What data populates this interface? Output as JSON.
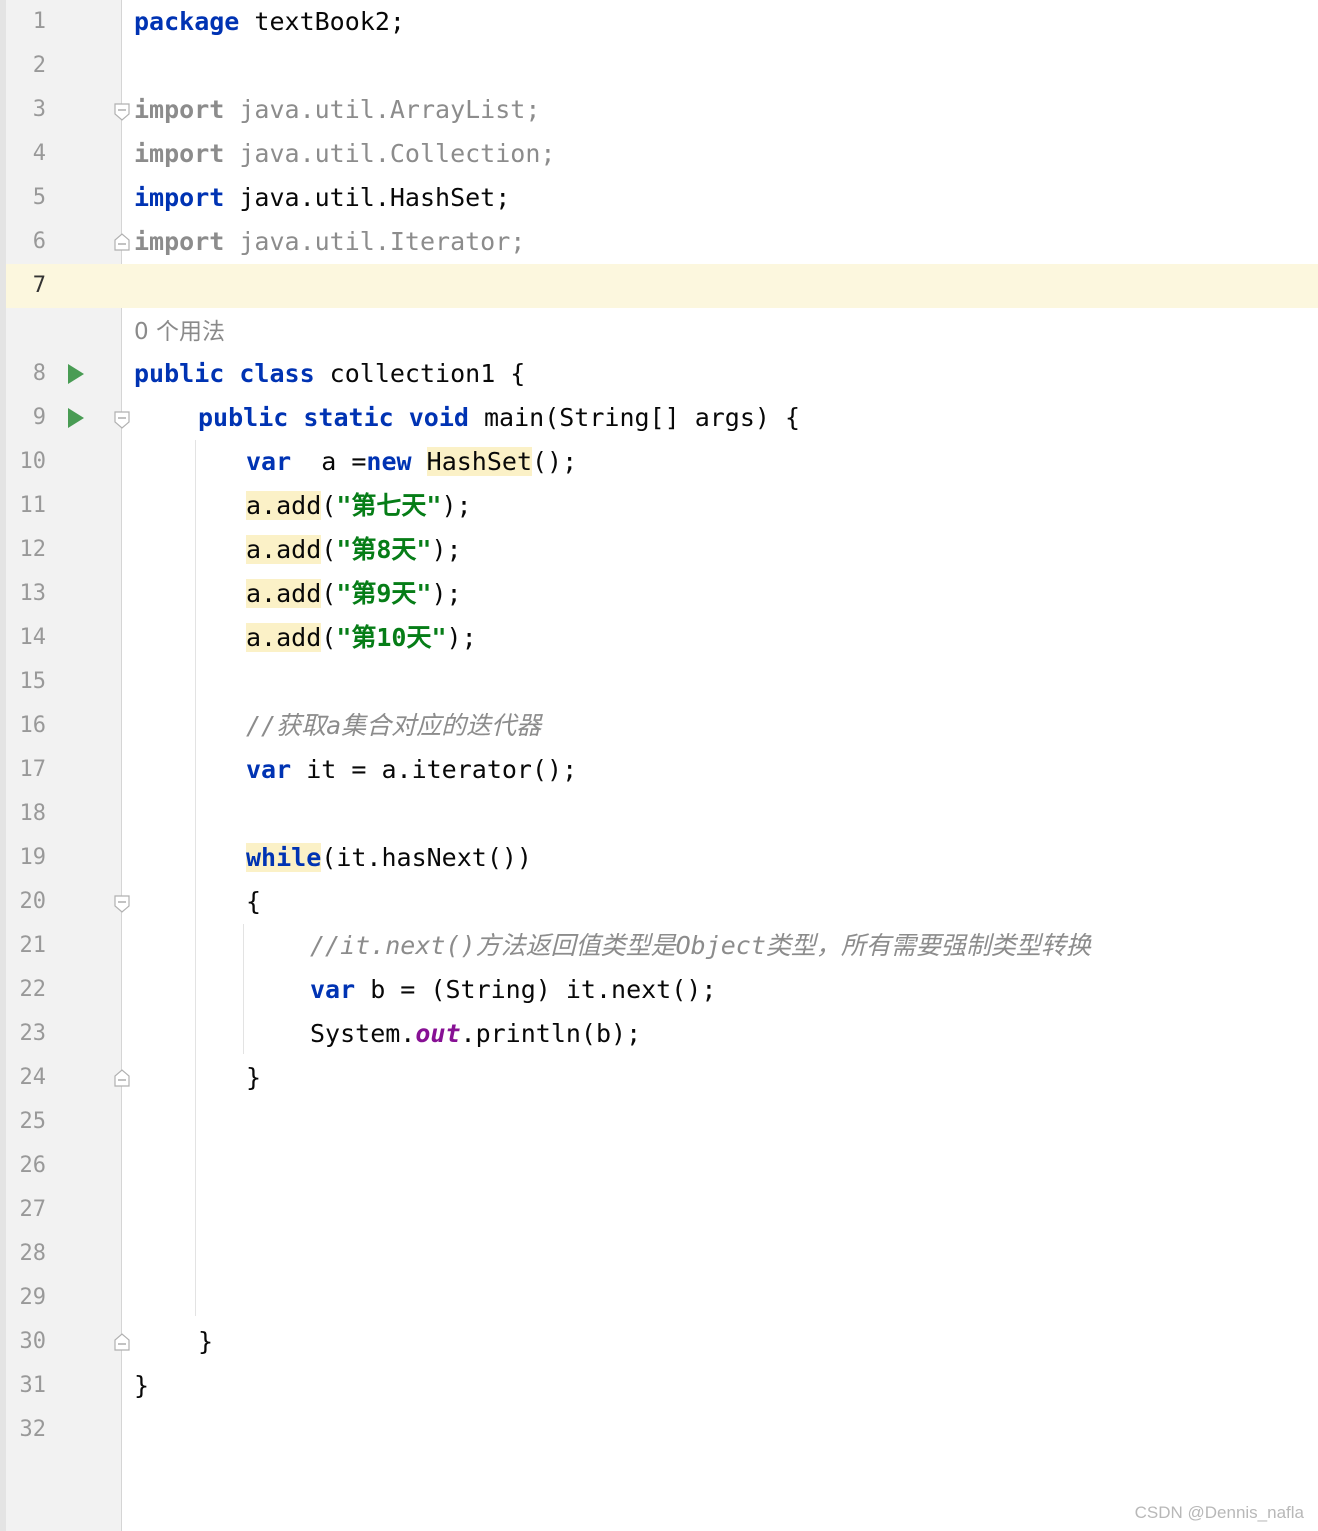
{
  "editor": {
    "line_numbers": [
      "1",
      "2",
      "3",
      "4",
      "5",
      "6",
      "7",
      "8",
      "9",
      "10",
      "11",
      "12",
      "13",
      "14",
      "15",
      "16",
      "17",
      "18",
      "19",
      "20",
      "21",
      "22",
      "23",
      "24",
      "25",
      "26",
      "27",
      "28",
      "29",
      "30",
      "31",
      "32"
    ],
    "current_line": "7",
    "usage_hint": "0 个用法",
    "code": {
      "l1": {
        "kw": "package",
        "rest": " textBook2;"
      },
      "l3": {
        "kw": "import",
        "rest": " java.util.ArrayList;"
      },
      "l4": {
        "kw": "import",
        "rest": " java.util.Collection;"
      },
      "l5": {
        "kw": "import",
        "rest": " java.util.HashSet;"
      },
      "l6": {
        "kw": "import",
        "rest": " java.util.Iterator;"
      },
      "l8": {
        "kw": "public class",
        "rest": " collection1 {"
      },
      "l9": {
        "kw": "public static void",
        "rest": " main(String[] args) {"
      },
      "l10": {
        "kw1": "var",
        "mid": "  a =",
        "kw2": "new",
        "sp": " ",
        "cls": "HashSet",
        "rest": "();"
      },
      "l11": {
        "obj": "a.add",
        "open": "(",
        "str": "\"第七天\"",
        "close": ");"
      },
      "l12": {
        "obj": "a.add",
        "open": "(",
        "str": "\"第8天\"",
        "close": ");"
      },
      "l13": {
        "obj": "a.add",
        "open": "(",
        "str": "\"第9天\"",
        "close": ");"
      },
      "l14": {
        "obj": "a.add",
        "open": "(",
        "str": "\"第10天\"",
        "close": ");"
      },
      "l16": {
        "comment": "//获取a集合对应的迭代器"
      },
      "l17": {
        "kw": "var",
        "rest": " it = a.iterator();"
      },
      "l19": {
        "kw": "while",
        "rest": "(it.hasNext())"
      },
      "l20": {
        "text": "{"
      },
      "l21": {
        "comment": "//it.next()方法返回值类型是Object类型，所有需要强制类型转换"
      },
      "l22": {
        "kw": "var",
        "rest": " b = (String) it.next();"
      },
      "l23": {
        "pre": "System.",
        "field": "out",
        "rest": ".println(b);"
      },
      "l24": {
        "text": "}"
      },
      "l30": {
        "text": "}"
      },
      "l31": {
        "text": "}"
      }
    }
  },
  "watermark": "CSDN @Dennis_nafla",
  "colors": {
    "keyword": "#0033b3",
    "string": "#067d17",
    "comment": "#8c8c8c",
    "static_field": "#871094",
    "current_line": "#fcf7de",
    "highlight": "#fbf1c7",
    "run_icon": "#499c54"
  }
}
